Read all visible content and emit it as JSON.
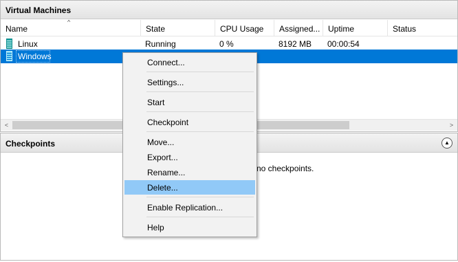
{
  "vm_panel": {
    "title": "Virtual Machines",
    "columns": [
      "Name",
      "State",
      "CPU Usage",
      "Assigned...",
      "Uptime",
      "Status"
    ],
    "sort_indicator": "^",
    "rows": [
      {
        "name": "Linux",
        "state": "Running",
        "cpu": "0 %",
        "assigned": "8192 MB",
        "uptime": "00:00:54",
        "status": ""
      },
      {
        "name": "Windows",
        "state": "",
        "cpu": "",
        "assigned": "",
        "uptime": "",
        "status": ""
      }
    ],
    "scroll_left": "<",
    "scroll_right": ">"
  },
  "checkpoints_panel": {
    "title": "Checkpoints",
    "empty_message": "no checkpoints.",
    "collapse_glyph": "▲"
  },
  "context_menu": {
    "items": [
      {
        "label": "Connect..."
      },
      {
        "label": "Settings..."
      },
      {
        "label": "Start"
      },
      {
        "label": "Checkpoint"
      },
      {
        "label": "Move..."
      },
      {
        "label": "Export..."
      },
      {
        "label": "Rename..."
      },
      {
        "label": "Delete...",
        "highlighted": true
      },
      {
        "label": "Enable Replication..."
      },
      {
        "label": "Help"
      }
    ]
  },
  "colors": {
    "selection": "#0078d7",
    "menu_highlight": "#91c9f7",
    "vm_icon": "#1aa3a3"
  }
}
